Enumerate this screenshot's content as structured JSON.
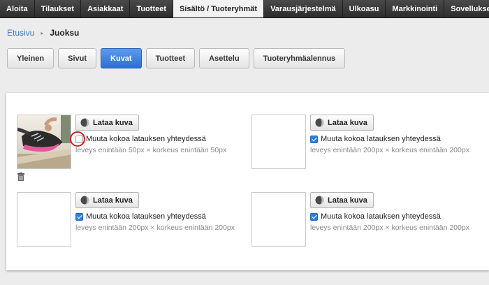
{
  "nav": {
    "items": [
      {
        "label": "Aloita"
      },
      {
        "label": "Tilaukset"
      },
      {
        "label": "Asiakkaat"
      },
      {
        "label": "Tuotteet"
      },
      {
        "label": "Sisältö / Tuoteryhmät"
      },
      {
        "label": "Varausjärjestelmä"
      },
      {
        "label": "Ulkoasu"
      },
      {
        "label": "Markkinointi"
      },
      {
        "label": "Sovellukset ja teemat"
      }
    ],
    "active_index": 4
  },
  "breadcrumb": {
    "home": "Etusivu",
    "current": "Juoksu"
  },
  "tabs": [
    {
      "label": "Yleinen"
    },
    {
      "label": "Sivut"
    },
    {
      "label": "Kuvat"
    },
    {
      "label": "Tuotteet"
    },
    {
      "label": "Asettelu"
    },
    {
      "label": "Tuoteryhmäalennus"
    }
  ],
  "active_tab": 2,
  "image_slots": [
    {
      "upload_label": "Lataa kuva",
      "resize_label": "Muuta kokoa latauksen yhteydessä",
      "resize_checked": false,
      "size_hint": "leveys enintään 50px × korkeus enintään 50px",
      "has_image": true
    },
    {
      "upload_label": "Lataa kuva",
      "resize_label": "Muuta kokoa latauksen yhteydessä",
      "resize_checked": true,
      "size_hint": "leveys enintään 200px × korkeus enintään 200px",
      "has_image": false
    },
    {
      "upload_label": "Lataa kuva",
      "resize_label": "Muuta kokoa latauksen yhteydessä",
      "resize_checked": true,
      "size_hint": "leveys enintään 200px × korkeus enintään 200px",
      "has_image": false
    },
    {
      "upload_label": "Lataa kuva",
      "resize_label": "Muuta kokoa latauksen yhteydessä",
      "resize_checked": true,
      "size_hint": "leveys enintään 200px × korkeus enintään 200px",
      "has_image": false
    }
  ],
  "icons": {
    "upload": "upload-globe-icon",
    "delete": "trash-icon"
  },
  "colors": {
    "nav_bg": "#3a3a3a",
    "active_tab": "#2c6fd4",
    "link": "#3a79c8",
    "checkbox": "#2f7fe0",
    "highlight": "#d0202a"
  }
}
